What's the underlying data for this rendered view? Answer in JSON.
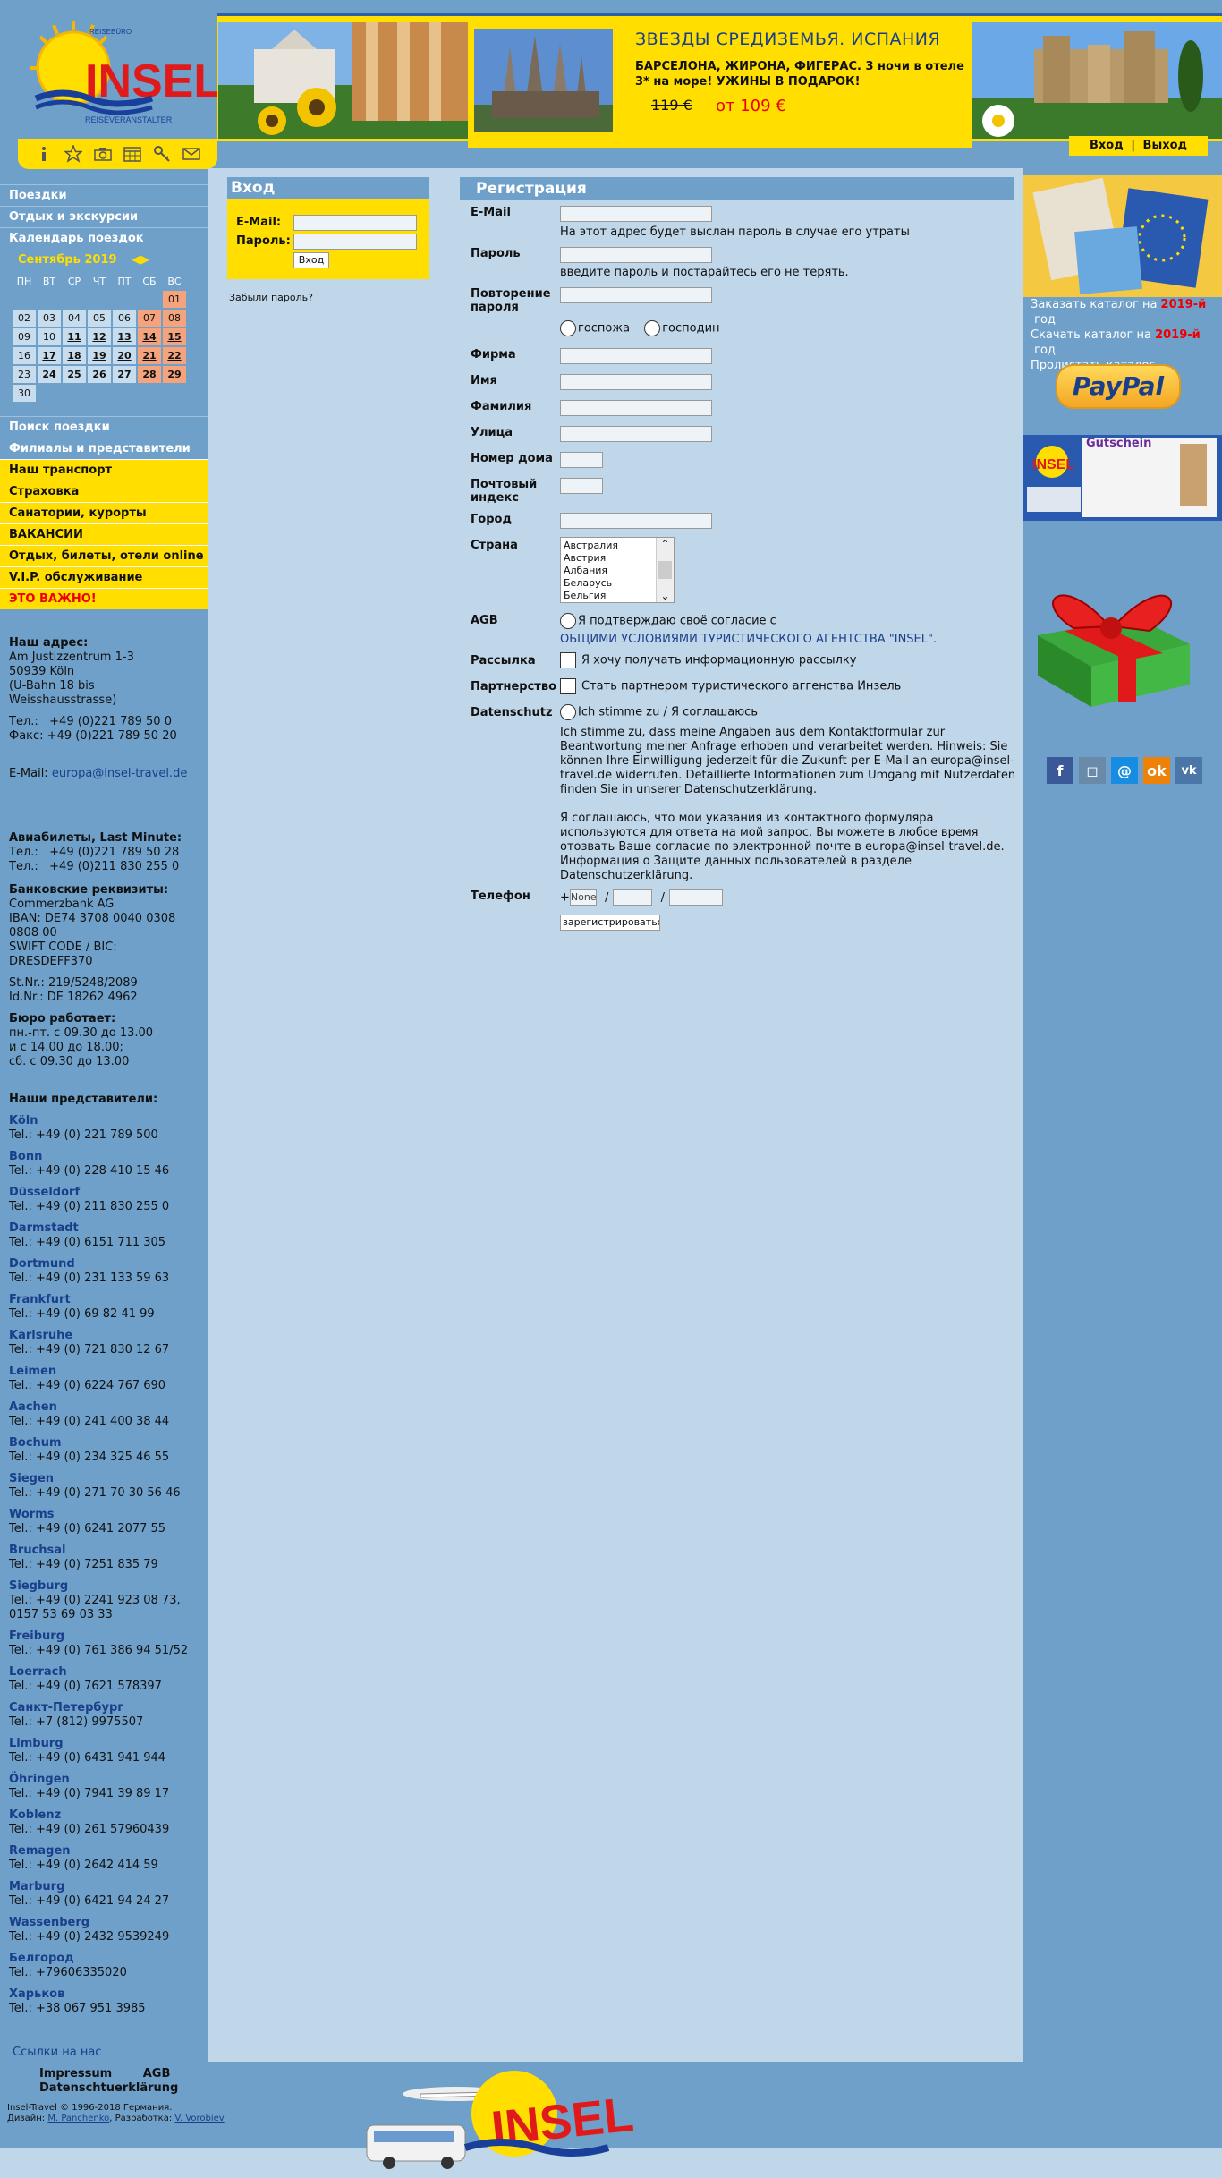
{
  "header": {
    "logo_top": "REISEBÜRO",
    "logo_main": "INSEL",
    "logo_bottom": "REISEVERANSTALTER",
    "promo_title": "ЗВЕЗДЫ СРЕДИЗЕМЬЯ. ИСПАНИЯ",
    "promo_sub": "БАРСЕЛОНА, ЖИРОНА, ФИГЕРАС. 3 ночи в отеле 3* на море! УЖИНЫ В ПОДАРОК!",
    "promo_old": "119 €",
    "promo_new": "от 109 €",
    "login_link": "Вход",
    "sep": "|",
    "logout_link": "Выход"
  },
  "icons": [
    "info-icon",
    "star-icon",
    "camera-icon",
    "calendar-icon",
    "key-icon",
    "mail-icon"
  ],
  "nav_top": [
    "Поездки",
    "Отдых и экскурсии",
    "Календарь поездок"
  ],
  "calendar": {
    "month": "Сентябрь 2019",
    "days": [
      "ПН",
      "ВТ",
      "СР",
      "ЧТ",
      "ПТ",
      "СБ",
      "ВС"
    ]
  },
  "nav_mid": [
    "Поиск поездки",
    "Филиалы и представители"
  ],
  "nav_yellow": [
    "Наш транспорт",
    "Страховка",
    "Санатории, курорты",
    "ВАКАНСИИ",
    "Отдых, билеты, отели online",
    "V.I.P. обслуживание",
    "ЭТО ВАЖНО!"
  ],
  "address": {
    "head": "Наш адрес:",
    "l1": "Am Justizzentrum 1-3",
    "l2": "50939 Köln",
    "l3": "(U-Bahn 18 bis",
    "l4": "Weisshausstrasse)",
    "tel": "Тел.:   +49 (0)221 789 50 0",
    "fax": "Факс: +49 (0)221 789 50 20",
    "email_label": "E-Mail: ",
    "email": "europa@insel-travel.de",
    "avia_head": "Авиабилеты, Last Minute:",
    "avia1": "Тел.:   +49 (0)221 789 50 28",
    "avia2": "Тел.:   +49 (0)211 830 255 0",
    "bank_head": "Банковские реквизиты:",
    "bank1": "Commerzbank AG",
    "bank2": "IBAN: DE74 3708 0040 0308 0808 00",
    "bank3": "SWIFT CODE / BIC: DRESDEFF370",
    "st": "St.Nr.: 219/5248/2089",
    "id": "Id.Nr.: DE 18262 4962",
    "hours_head": "Бюро работает:",
    "h1": "пн.-пт. с 09.30 до 13.00",
    "h2": "и с 14.00 до 18.00;",
    "h3": "сб. с 09.30 до 13.00",
    "reps_head": "Наши представители:"
  },
  "reps": [
    {
      "city": "Köln",
      "tel": "Tel.: +49 (0) 221 789 500"
    },
    {
      "city": "Bonn",
      "tel": "Tel.: +49 (0) 228 410 15 46"
    },
    {
      "city": "Düsseldorf",
      "tel": "Tel.: +49 (0) 211 830 255 0"
    },
    {
      "city": "Darmstadt",
      "tel": "Tel.: +49 (0) 6151 711 305"
    },
    {
      "city": "Dortmund",
      "tel": "Tel.: +49 (0) 231 133 59 63"
    },
    {
      "city": "Frankfurt",
      "tel": "Tel.: +49 (0) 69 82 41 99"
    },
    {
      "city": "Karlsruhe",
      "tel": "Tel.: +49 (0) 721 830 12 67"
    },
    {
      "city": "Leimen",
      "tel": "Tel.: +49 (0) 6224 767 690"
    },
    {
      "city": "Aachen",
      "tel": "Tel.: +49 (0) 241 400 38 44"
    },
    {
      "city": "Bochum",
      "tel": "Tel.: +49 (0) 234 325 46 55"
    },
    {
      "city": "Siegen",
      "tel": "Tel.: +49 (0) 271 70 30 56 46"
    },
    {
      "city": "Worms",
      "tel": "Tel.: +49 (0) 6241 2077 55"
    },
    {
      "city": "Bruchsal",
      "tel": "Tel.: +49 (0) 7251 835 79"
    },
    {
      "city": "Siegburg",
      "tel": "Tel.: +49 (0) 2241 923 08 73, 0157 53 69 03 33"
    },
    {
      "city": "Freiburg",
      "tel": "Tel.: +49 (0) 761 386 94 51/52"
    },
    {
      "city": "Loerrach",
      "tel": "Tel.: +49 (0) 7621 578397"
    },
    {
      "city": "Санкт-Петербург",
      "tel": "Tel.: +7 (812) 9975507"
    },
    {
      "city": "Limburg",
      "tel": "Tel.: +49 (0) 6431 941 944"
    },
    {
      "city": "Öhringen",
      "tel": "Tel.: +49 (0) 7941 39 89 17"
    },
    {
      "city": "Koblenz",
      "tel": "Tel.: +49 (0) 261 57960439"
    },
    {
      "city": "Remagen",
      "tel": "Tel.: +49 (0) 2642 414 59"
    },
    {
      "city": "Marburg",
      "tel": "Tel.: +49 (0) 6421 94 24 27"
    },
    {
      "city": "Wassenberg",
      "tel": "Tel.: +49 (0) 2432 9539249"
    },
    {
      "city": "Белгород",
      "tel": "Tel.: +79606335020"
    },
    {
      "city": "Харьков",
      "tel": "Tel.: +38 067 951 3985"
    }
  ],
  "login": {
    "title": "Вход",
    "email_label": "E-Mail:",
    "pass_label": "Пароль:",
    "button": "Вход",
    "forgot": "Забыли пароль?"
  },
  "register": {
    "title": "Регистрация",
    "email": "E-Mail",
    "email_hint": "На этот адрес будет выслан пароль в случае его утраты",
    "password": "Пароль",
    "password_hint": "введите пароль и постарайтесь его не терять.",
    "repeat": "Повторение пароля",
    "ms": "госпожа",
    "mr": "господин",
    "firm": "Фирма",
    "name": "Имя",
    "surname": "Фамилия",
    "street": "Улица",
    "house": "Номер дома",
    "zip": "Почтовый индекс",
    "city": "Город",
    "country": "Страна",
    "countries": [
      "Австралия",
      "Австрия",
      "Албания",
      "Беларусь",
      "Бельгия"
    ],
    "agb": "AGB",
    "agb_text": "Я подтверждаю своё согласие с",
    "agb_link": "ОБЩИМИ УСЛОВИЯМИ ТУРИСТИЧЕСКОГО АГЕНТСТВА \"INSEL\".",
    "newsletter": "Рассылка",
    "newsletter_text": "Я хочу получать информационную рассылку",
    "partner": "Партнерство",
    "partner_text": "Стать партнером туристического аггенства Инзель",
    "privacy": "Datenschutz",
    "privacy_radio": "Ich stimme zu / Я соглашаюсь",
    "privacy_de": "Ich stimme zu, dass meine Angaben aus dem Kontaktformular zur Beantwortung meiner Anfrage erhoben und verarbeitet werden. Hinweis: Sie können Ihre Einwilligung jederzeit für die Zukunft per E-Mail an europa@insel-travel.de widerrufen. Detaillierte Informationen zum Umgang mit Nutzerdaten finden Sie in unserer Datenschutzerklärung.",
    "privacy_ru": "Я соглашаюсь, что мои указания из контактного формуляра используются для ответа на мой запрос. Вы можете в любое время отозвать Ваше согласие по электронной почте в europa@insel-travel.de. Информация о Защите данных пользователей в разделе Datenschutzerklärung.",
    "phone": "Телефон",
    "phone_plus": "+",
    "phone_code": "None",
    "phone_sep": "/",
    "submit": "зарегистрироваться"
  },
  "right": {
    "cat1_a": "Заказать каталог на ",
    "cat1_b": "2019-й",
    "cat1_c": " год",
    "cat2_a": "Скачать каталог на ",
    "cat2_b": "2019-й",
    "cat2_c": " год",
    "cat3": "Пролистать каталог",
    "paypal": "PayPal",
    "gutschein": "Gutschein"
  },
  "social": [
    "facebook-icon",
    "instagram-icon",
    "mailru-icon",
    "odnoklassniki-icon",
    "vk-icon"
  ],
  "footer": {
    "links_us": "Ссылки на нас",
    "impressum": "Impressum",
    "agb": "AGB",
    "datenschutz": "Datenschtuerklärung",
    "copy": "Insel-Travel © 1996-2018 Германия.",
    "design_label": "Дизайн: ",
    "designer": "M. Panchenko",
    "dev_label": ", Разработка: ",
    "developer": "V. Vorobiev"
  }
}
